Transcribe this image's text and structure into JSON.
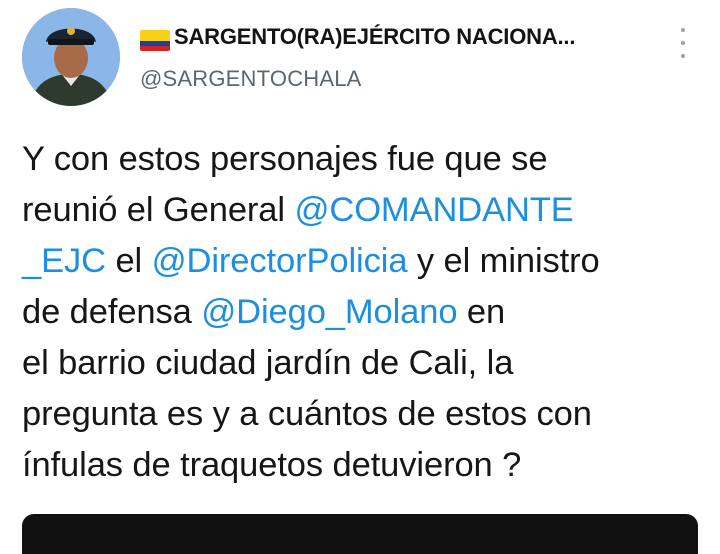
{
  "author": {
    "display_name": "SARGENTO(RA)EJÉRCITO NACIONA...",
    "handle": "@SARGENTOCHALA",
    "avatar_icon": "profile-photo",
    "flag_icon": "colombia-flag-emoji"
  },
  "menu": {
    "icon": "more-vertical-icon"
  },
  "tweet": {
    "lines": [
      [
        {
          "t": "Y con estos personajes fue que se"
        }
      ],
      [
        {
          "t": "reunió el General "
        },
        {
          "m": "@COMANDANTE"
        }
      ],
      [
        {
          "m": "_EJC"
        },
        {
          "t": " el "
        },
        {
          "m": "@DirectorPolicia"
        },
        {
          "t": " y el ministro"
        }
      ],
      [
        {
          "t": "de defensa "
        },
        {
          "m": "@Diego_Molano"
        },
        {
          "t": " en"
        }
      ],
      [
        {
          "t": "el barrio ciudad jardín de Cali, la"
        }
      ],
      [
        {
          "t": "pregunta es y a cuántos de estos con"
        }
      ],
      [
        {
          "t": "ínfulas de traquetos detuvieron ?"
        }
      ]
    ]
  },
  "colors": {
    "mention": "#1d8fe0",
    "text": "#161616",
    "handle": "#5b6670",
    "background": "#ffffff"
  }
}
